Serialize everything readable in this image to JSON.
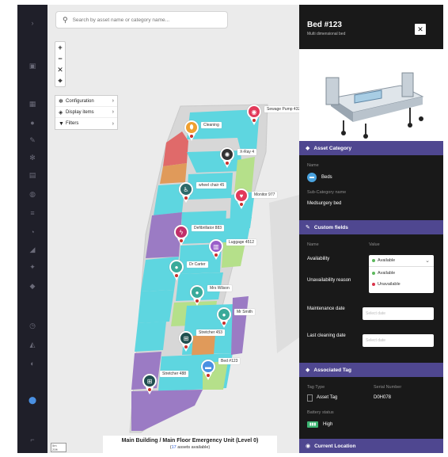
{
  "sidebar": {
    "icons": [
      "chevron-right-icon",
      "building-icon",
      "grid-icon",
      "user-icon",
      "pen-icon",
      "gear-icon",
      "document-icon",
      "globe-icon",
      "list-icon",
      "bell-icon",
      "bookmark-icon",
      "star-icon",
      "lock-icon",
      "chart-icon",
      "layers-icon",
      "location-icon",
      "exit-icon"
    ]
  },
  "map": {
    "search_placeholder": "Search by asset name or category name...",
    "zoom": {
      "in": "+",
      "out": "−",
      "reset": "✕",
      "locate": "⌖"
    },
    "menu": [
      {
        "label": "Configuration",
        "icon": "gear-icon"
      },
      {
        "label": "Display items",
        "icon": "layers-icon"
      },
      {
        "label": "Filters",
        "icon": "filter-icon"
      }
    ],
    "pins": [
      {
        "label": "Cleaning",
        "color": "#f0a030"
      },
      {
        "label": "Sewage Pump 432",
        "color": "#e23a5a"
      },
      {
        "label": "X-Ray 4",
        "color": "#333333"
      },
      {
        "label": "wheel chair 45",
        "color": "#2d6a6a"
      },
      {
        "label": "Monitor 977",
        "color": "#e23a5a"
      },
      {
        "label": "Defibrillator 883",
        "color": "#c0306a"
      },
      {
        "label": "Luggage 4512",
        "color": "#9a5fc9"
      },
      {
        "label": "Dr Carter",
        "color": "#3aaa9a"
      },
      {
        "label": "Mrs Wilson",
        "color": "#3aaa9a"
      },
      {
        "label": "Mr Smith",
        "color": "#3aaa9a"
      },
      {
        "label": "Stretcher 453",
        "color": "#1f4f4f"
      },
      {
        "label": "Bed #123",
        "color": "#4a90e2"
      },
      {
        "label": "Stretcher 488",
        "color": "#1f4f4f"
      }
    ],
    "caption": {
      "title": "Main Building / Main Floor Emergency Unit (Level 0)",
      "count": "17",
      "suffix": " assets available)",
      "prefix": "("
    },
    "scale_lines": [
      "5m",
      "20ft"
    ]
  },
  "panel": {
    "title": "Bed #123",
    "subtitle": "Multi dimensional bed",
    "close": "✕",
    "asset_category": {
      "header": "Asset Category",
      "name_label": "Name",
      "name_value": "Beds",
      "subcategory_label": "Sub-Category name",
      "subcategory_value": "Medsurgery bed"
    },
    "custom_fields": {
      "header": "Custom fields",
      "col_name": "Name",
      "col_value": "Value",
      "rows": [
        {
          "label": "Availability"
        },
        {
          "label": "Unavailability reason"
        },
        {
          "label": "Maintenance date",
          "placeholder": "Select date"
        },
        {
          "label": "Last cleaning date",
          "placeholder": "Select date"
        }
      ],
      "availability_selected": "Available",
      "availability_options": [
        {
          "label": "Available",
          "color": "#5cb85c"
        },
        {
          "label": "Unavailable",
          "color": "#d9334a"
        }
      ]
    },
    "associated_tag": {
      "header": "Associated Tag",
      "tag_type_label": "Tag Type",
      "tag_type_value": "Asset Tag",
      "serial_label": "Serial Number",
      "serial_value": "D0H078",
      "battery_label": "Battery status",
      "battery_value": "High"
    },
    "current_location": {
      "header": "Current Location"
    }
  },
  "colors": {
    "accent": "#4f4790",
    "panel_bg": "#191919",
    "sidebar_bg": "#1f1f29",
    "room_cyan": "#5ed6e0",
    "room_purple": "#9b7bc4",
    "room_orange": "#e09a5a",
    "room_green": "#b5e08a",
    "room_red": "#e06a6a"
  }
}
